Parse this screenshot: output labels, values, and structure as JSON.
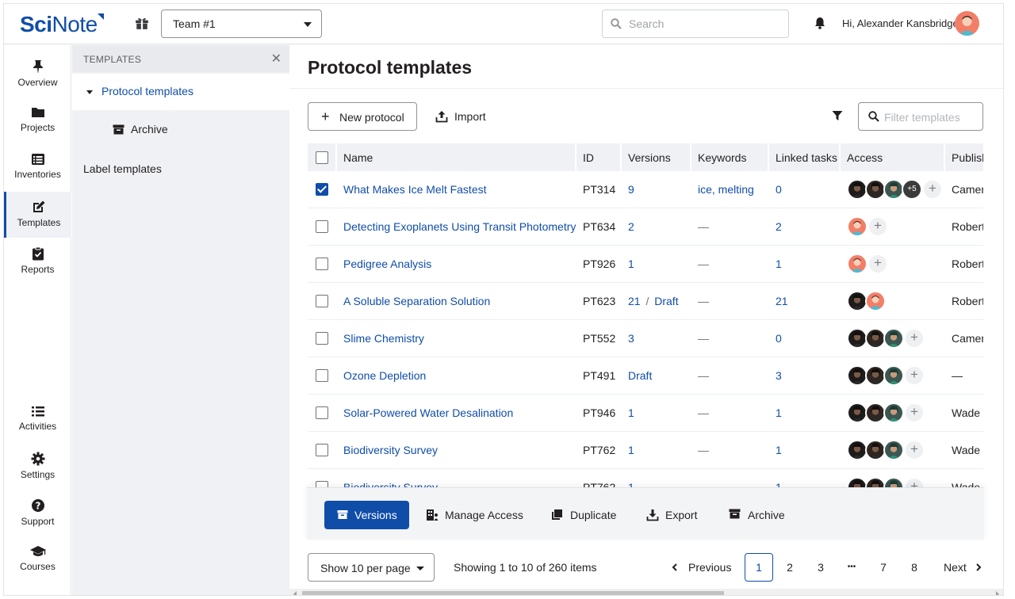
{
  "app": {
    "logo_bold": "Sci",
    "logo_light": "Note",
    "team": "Team #1",
    "search_placeholder": "Search",
    "greeting": "Hi, Alexander Kansbridge"
  },
  "rail": {
    "top": [
      {
        "label": "Overview",
        "icon": "pin-icon"
      },
      {
        "label": "Projects",
        "icon": "folder-icon"
      },
      {
        "label": "Inventories",
        "icon": "list-box-icon"
      },
      {
        "label": "Templates",
        "icon": "edit-icon"
      },
      {
        "label": "Reports",
        "icon": "clipboard-check-icon"
      }
    ],
    "bottom": [
      {
        "label": "Activities",
        "icon": "list-icon"
      },
      {
        "label": "Settings",
        "icon": "gear-icon"
      },
      {
        "label": "Support",
        "icon": "question-icon"
      },
      {
        "label": "Courses",
        "icon": "graduation-cap-icon"
      }
    ]
  },
  "subnav": {
    "header": "TEMPLATES",
    "protocol_templates": "Protocol templates",
    "archive": "Archive",
    "label_templates": "Label templates"
  },
  "main": {
    "title": "Protocol templates",
    "new_protocol": "New protocol",
    "import": "Import",
    "filter_placeholder": "Filter templates"
  },
  "table": {
    "headers": {
      "name": "Name",
      "id": "ID",
      "versions": "Versions",
      "keywords": "Keywords",
      "linked": "Linked tasks",
      "access": "Access",
      "published": "Publish"
    },
    "rows": [
      {
        "name": "What Makes Ice Melt Fastest",
        "id": "PT314",
        "version": "9",
        "draft": "",
        "keywords": "ice, melting",
        "linked": "0",
        "published": "Camer",
        "checked": true
      },
      {
        "name": "Detecting Exoplanets Using Transit Photometry",
        "id": "PT634",
        "version": "2",
        "draft": "",
        "keywords": "—",
        "linked": "2",
        "published": "Robert",
        "checked": false
      },
      {
        "name": "Pedigree Analysis",
        "id": "PT926",
        "version": "1",
        "draft": "",
        "keywords": "—",
        "linked": "1",
        "published": "Robert",
        "checked": false
      },
      {
        "name": "A Soluble Separation Solution",
        "id": "PT623",
        "version": "21",
        "draft": "Draft",
        "keywords": "—",
        "linked": "21",
        "published": "Robert",
        "checked": false
      },
      {
        "name": "Slime Chemistry",
        "id": "PT552",
        "version": "3",
        "draft": "",
        "keywords": "—",
        "linked": "0",
        "published": "Camer",
        "checked": false
      },
      {
        "name": "Ozone Depletion",
        "id": "PT491",
        "version": "",
        "draft": "Draft",
        "keywords": "—",
        "linked": "3",
        "published": "—",
        "checked": false
      },
      {
        "name": "Solar-Powered Water Desalination",
        "id": "PT946",
        "version": "1",
        "draft": "",
        "keywords": "—",
        "linked": "1",
        "published": "Wade",
        "checked": false
      },
      {
        "name": "Biodiversity Survey",
        "id": "PT762",
        "version": "1",
        "draft": "",
        "keywords": "—",
        "linked": "1",
        "published": "Wade",
        "checked": false
      }
    ],
    "more_count": "+5",
    "version_separator": "/"
  },
  "actions": {
    "versions": "Versions",
    "manage_access": "Manage Access",
    "duplicate": "Duplicate",
    "export": "Export",
    "archive": "Archive"
  },
  "pagination": {
    "per_page": "Show 10 per page",
    "showing": "Showing 1 to 10 of 260 items",
    "previous": "Previous",
    "next": "Next",
    "pages": [
      "1",
      "2",
      "3",
      "•••",
      "7",
      "8"
    ],
    "current": "1"
  },
  "colors": {
    "brand": "#104da9",
    "header_bg": "#eff1f4",
    "panel_bg": "#f0f1f4"
  }
}
